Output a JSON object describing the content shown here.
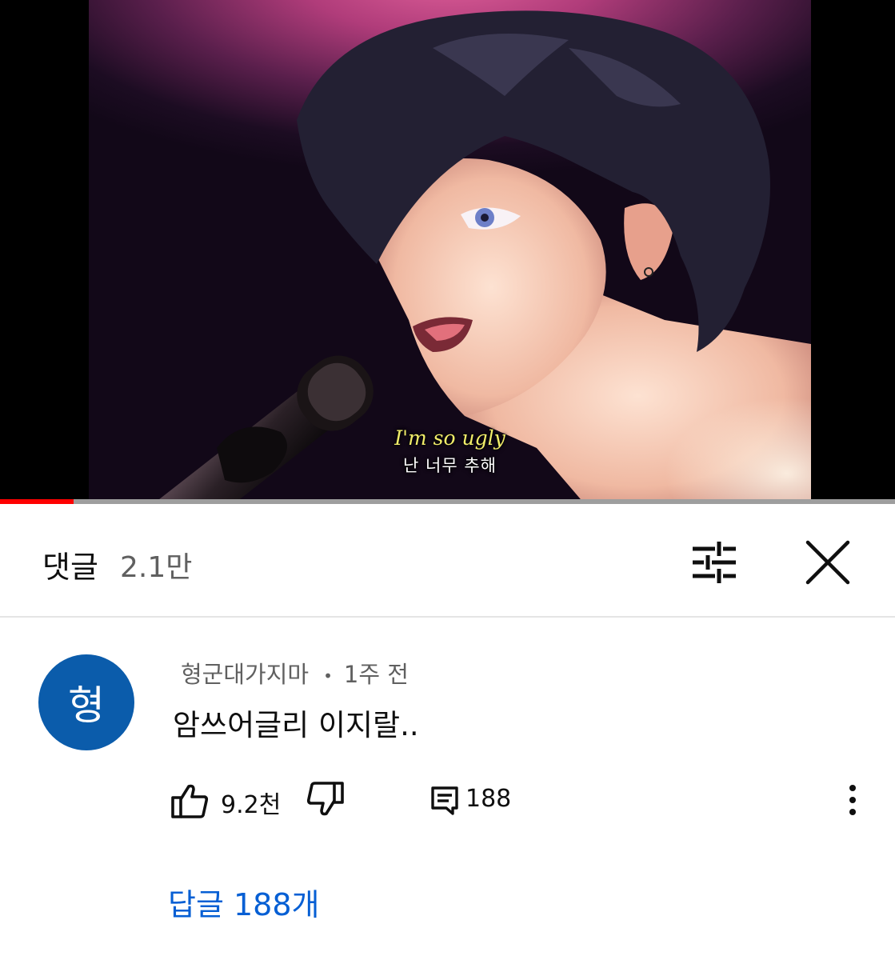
{
  "video": {
    "subtitle_en": "I'm so ugly",
    "subtitle_ko": "난 너무 추해",
    "progress_fraction": 0.082
  },
  "comments_header": {
    "title": "댓글",
    "count": "2.1만",
    "icons": {
      "filter": "sliders-icon",
      "close": "close-icon"
    }
  },
  "comment": {
    "avatar_letter": "형",
    "avatar_color": "#0b5cab",
    "author": "형군대가지마",
    "separator": "•",
    "time": "1주 전",
    "text": "암쓰어글리 이지랄..",
    "likes": "9.2천",
    "reply_count": "188",
    "replies_link": "답글 188개",
    "icons": {
      "like": "thumbs-up-icon",
      "dislike": "thumbs-down-icon",
      "reply": "reply-icon",
      "more": "more-vert-icon"
    }
  },
  "colors": {
    "link": "#065fd4",
    "progress": "#ff0000"
  }
}
